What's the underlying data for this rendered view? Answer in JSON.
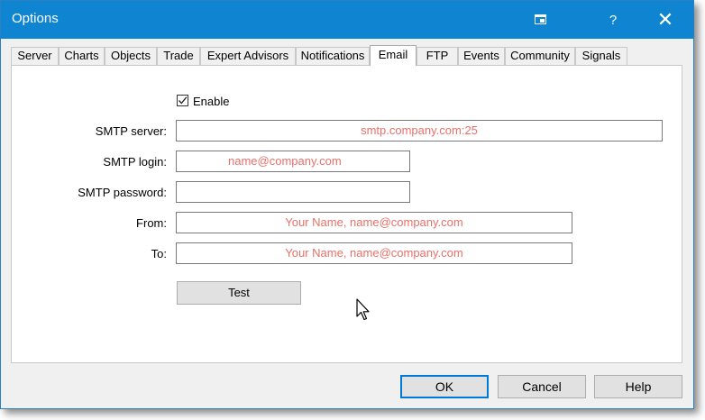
{
  "window": {
    "title": "Options",
    "help_glyph": "?",
    "close_glyph": "✕"
  },
  "tabs": [
    {
      "label": "Server"
    },
    {
      "label": "Charts"
    },
    {
      "label": "Objects"
    },
    {
      "label": "Trade"
    },
    {
      "label": "Expert Advisors"
    },
    {
      "label": "Notifications"
    },
    {
      "label": "Email",
      "active": true
    },
    {
      "label": "FTP"
    },
    {
      "label": "Events"
    },
    {
      "label": "Community"
    },
    {
      "label": "Signals"
    }
  ],
  "email": {
    "enable_label": "Enable",
    "enable_checked": true,
    "smtp_server_label": "SMTP server:",
    "smtp_server_value": "smtp.company.com:25",
    "smtp_login_label": "SMTP login:",
    "smtp_login_value": "name@company.com",
    "smtp_password_label": "SMTP password:",
    "smtp_password_value": "",
    "from_label": "From:",
    "from_value": "Your Name, name@company.com",
    "to_label": "To:",
    "to_value": "Your Name, name@company.com",
    "test_label": "Test"
  },
  "footer": {
    "ok_label": "OK",
    "cancel_label": "Cancel",
    "help_label": "Help"
  },
  "colors": {
    "titlebar": "#0f85d2",
    "field_text": "#e8706a",
    "default_button_border": "#0078d7"
  }
}
